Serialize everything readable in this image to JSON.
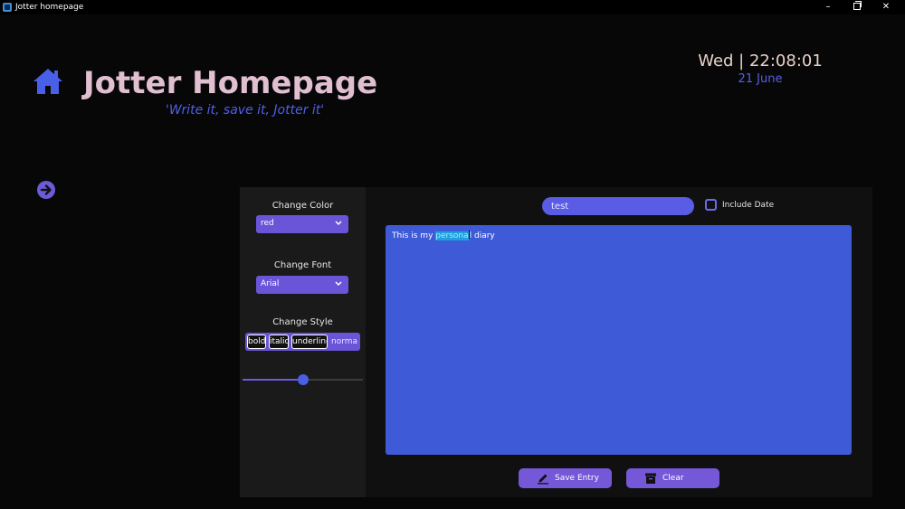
{
  "window": {
    "title": "Jotter homepage",
    "minimize": "–",
    "close": "✕"
  },
  "header": {
    "title": "Jotter Homepage",
    "tagline": "'Write it, save it, Jotter it'",
    "clock": "Wed  |  22:08:01",
    "date": "21 June"
  },
  "controls": {
    "color_label": "Change Color",
    "color_value": "red",
    "font_label": "Change Font",
    "font_value": "Arial",
    "style_label": "Change Style",
    "styles": [
      "bold",
      "italic",
      "underline",
      "normal"
    ],
    "style_active": "normal",
    "font_size_level": 0.5
  },
  "editor": {
    "entry_title": "test",
    "include_date_label": "Include Date",
    "include_date_checked": false,
    "text_before": "This is my ",
    "text_selected": "persona",
    "text_after": "l diary",
    "save_label": "Save Entry",
    "clear_label": "Clear"
  },
  "colors": {
    "accent_purple": "#6a55d9",
    "editor_blue": "#3f5ad6",
    "title_pink": "#e0bfd0",
    "tagline_blue": "#4f5fe8"
  },
  "icons": {
    "home": "home-icon",
    "arrow": "arrow-right-circle-icon",
    "save": "pencil-icon",
    "clear": "archive-box-icon",
    "dropdown": "chevron-down-icon"
  }
}
